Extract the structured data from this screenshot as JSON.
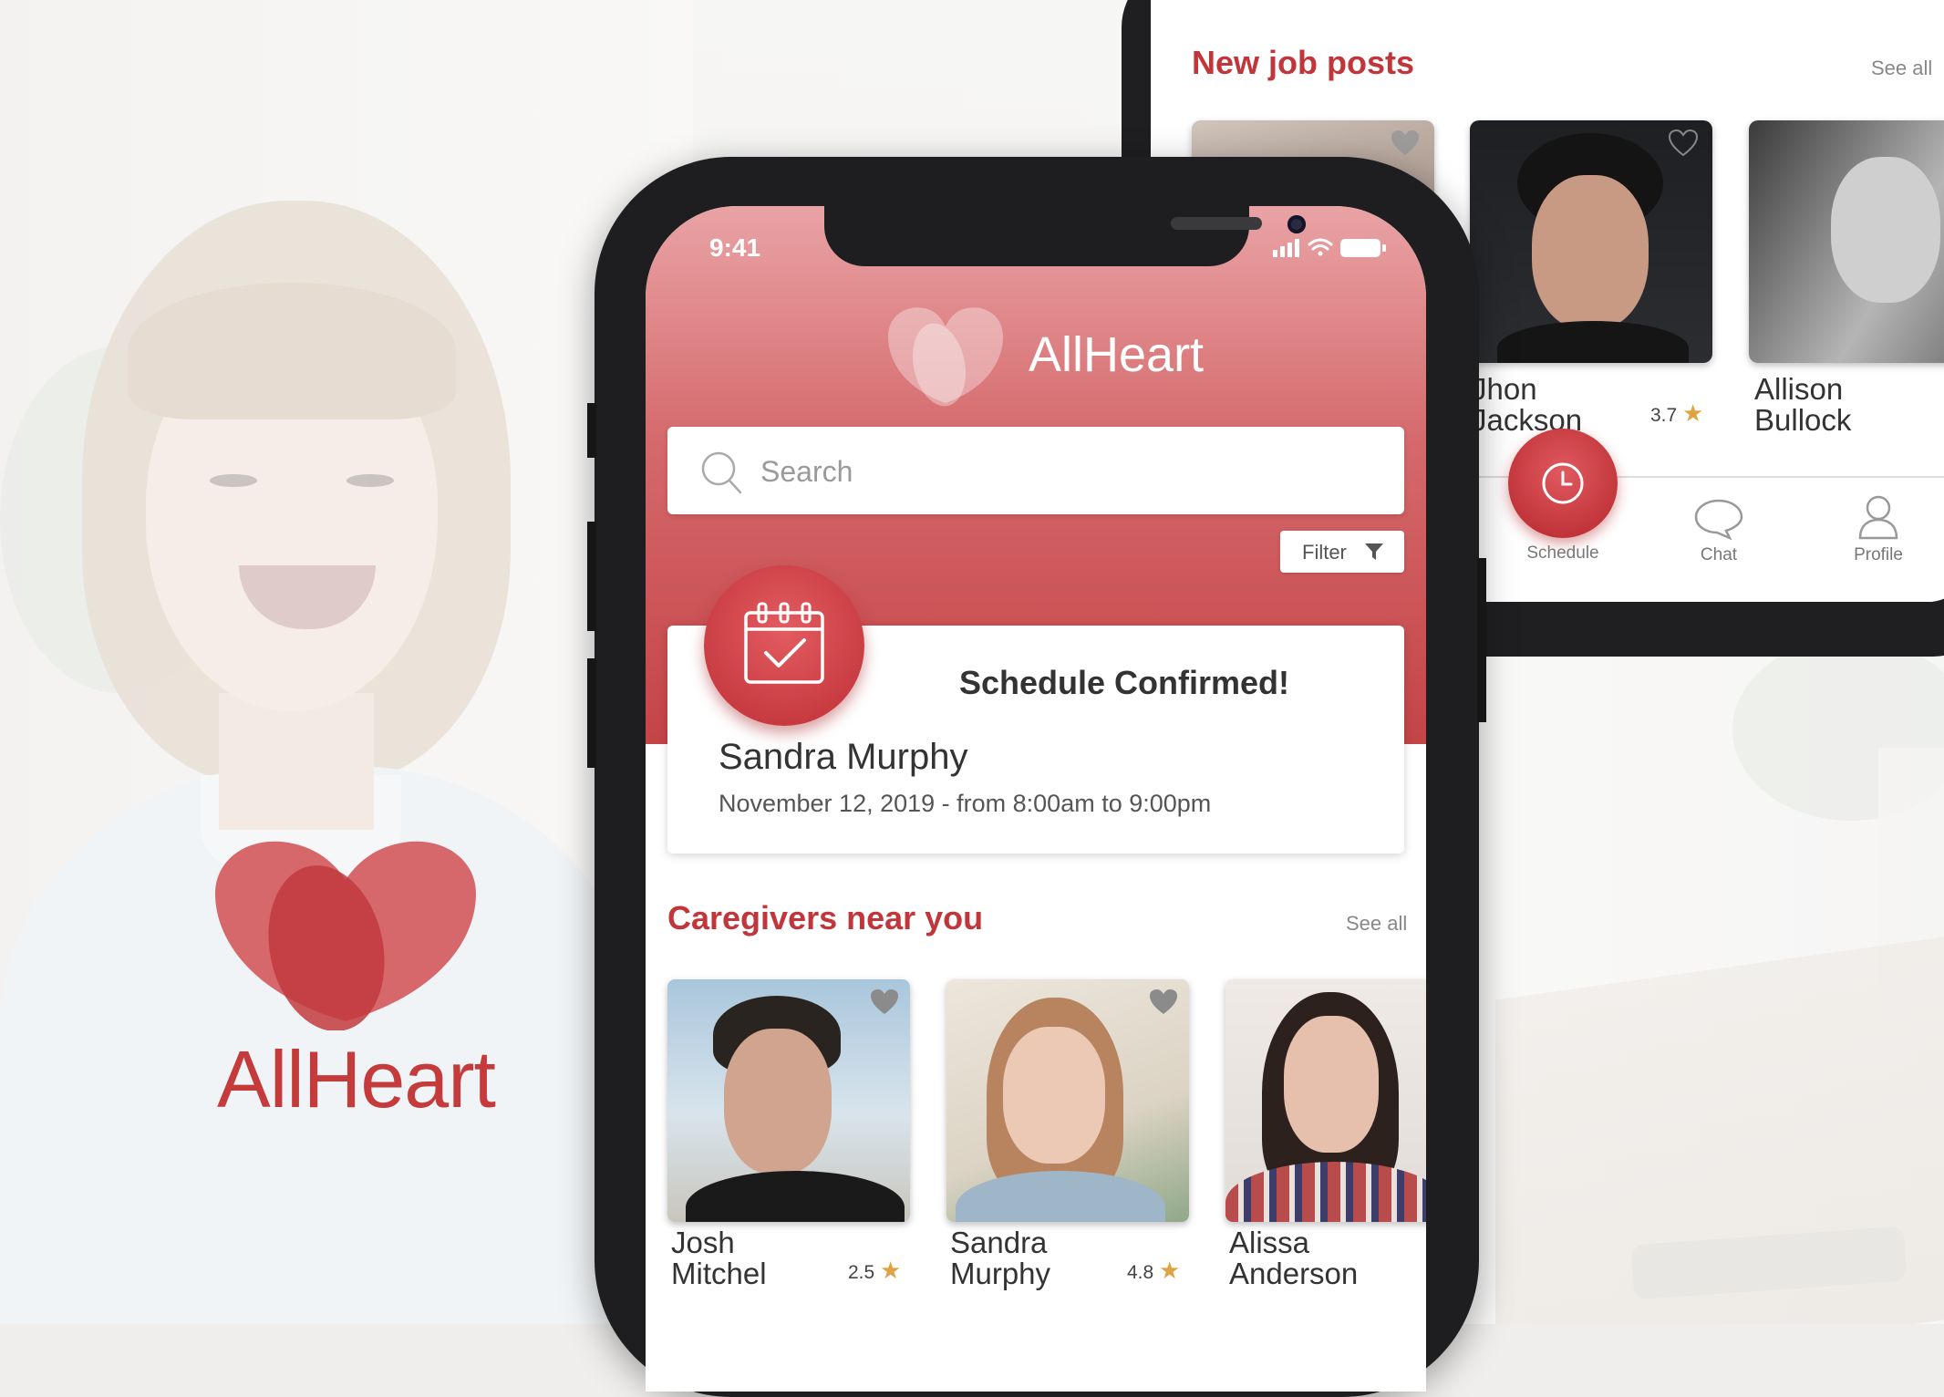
{
  "brand": {
    "name": "AllHeart",
    "primary_color": "#c53a3a"
  },
  "front_phone": {
    "status_bar": {
      "time": "9:41"
    },
    "app_title": "AllHeart",
    "search": {
      "placeholder": "Search"
    },
    "filter_label": "Filter",
    "schedule_card": {
      "title": "Schedule Confirmed!",
      "name": "Sandra Murphy",
      "date": "November 12, 2019 - from 8:00am to 9:00pm"
    },
    "caregivers": {
      "title": "Caregivers near you",
      "see_all": "See all",
      "items": [
        {
          "first": "Josh",
          "last": "Mitchel",
          "rating": "2.5"
        },
        {
          "first": "Sandra",
          "last": "Murphy",
          "rating": "4.8"
        },
        {
          "first": "Alissa",
          "last": "Anderson",
          "rating": ""
        }
      ]
    }
  },
  "back_phone": {
    "title": "New job posts",
    "see_all": "See all",
    "items": [
      {
        "first": "Jhon",
        "last": "Jackson",
        "rating": "3.7"
      },
      {
        "first": "Allison",
        "last": "Bullock",
        "rating": ""
      }
    ],
    "tabs": [
      {
        "label": "Schedule",
        "icon": "clock-icon"
      },
      {
        "label": "Chat",
        "icon": "chat-bubble-icon"
      },
      {
        "label": "Profile",
        "icon": "person-icon"
      }
    ]
  }
}
